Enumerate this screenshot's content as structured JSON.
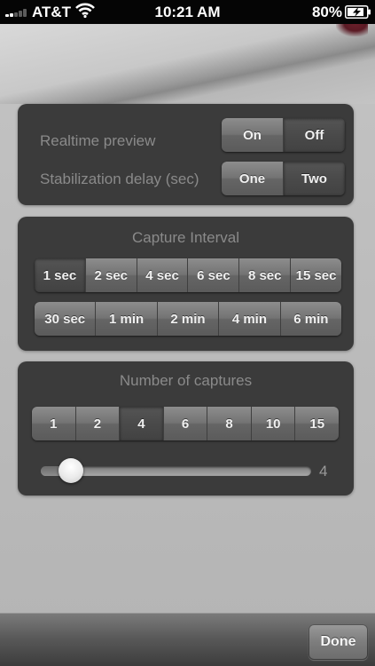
{
  "status_bar": {
    "carrier": "AT&T",
    "time": "10:21 AM",
    "battery": "80%",
    "signal_bars_filled": 2,
    "battery_level": 0.8,
    "icons": [
      "signal-icon",
      "wifi-icon",
      "battery-charging-icon"
    ]
  },
  "options": {
    "realtime_preview": {
      "label": "Realtime preview",
      "options": [
        "On",
        "Off"
      ],
      "selected": "Off"
    },
    "stabilization_delay": {
      "label": "Stabilization delay (sec)",
      "options": [
        "One",
        "Two"
      ],
      "selected": "Two"
    }
  },
  "capture_interval": {
    "title": "Capture Interval",
    "row1": [
      "1 sec",
      "2 sec",
      "4 sec",
      "6 sec",
      "8 sec",
      "15 sec"
    ],
    "row2": [
      "30 sec",
      "1 min",
      "2 min",
      "4 min",
      "6 min"
    ],
    "selected": "1 sec"
  },
  "number_of_captures": {
    "title": "Number of captures",
    "options": [
      "1",
      "2",
      "4",
      "6",
      "8",
      "10",
      "15"
    ],
    "selected": "4",
    "slider_value": "4",
    "slider_fraction": 0.11
  },
  "toolbar": {
    "done_label": "Done"
  },
  "colors": {
    "panel": "#3b3b3b",
    "label": "#8a8a8a",
    "background": "#bdbdbd"
  }
}
